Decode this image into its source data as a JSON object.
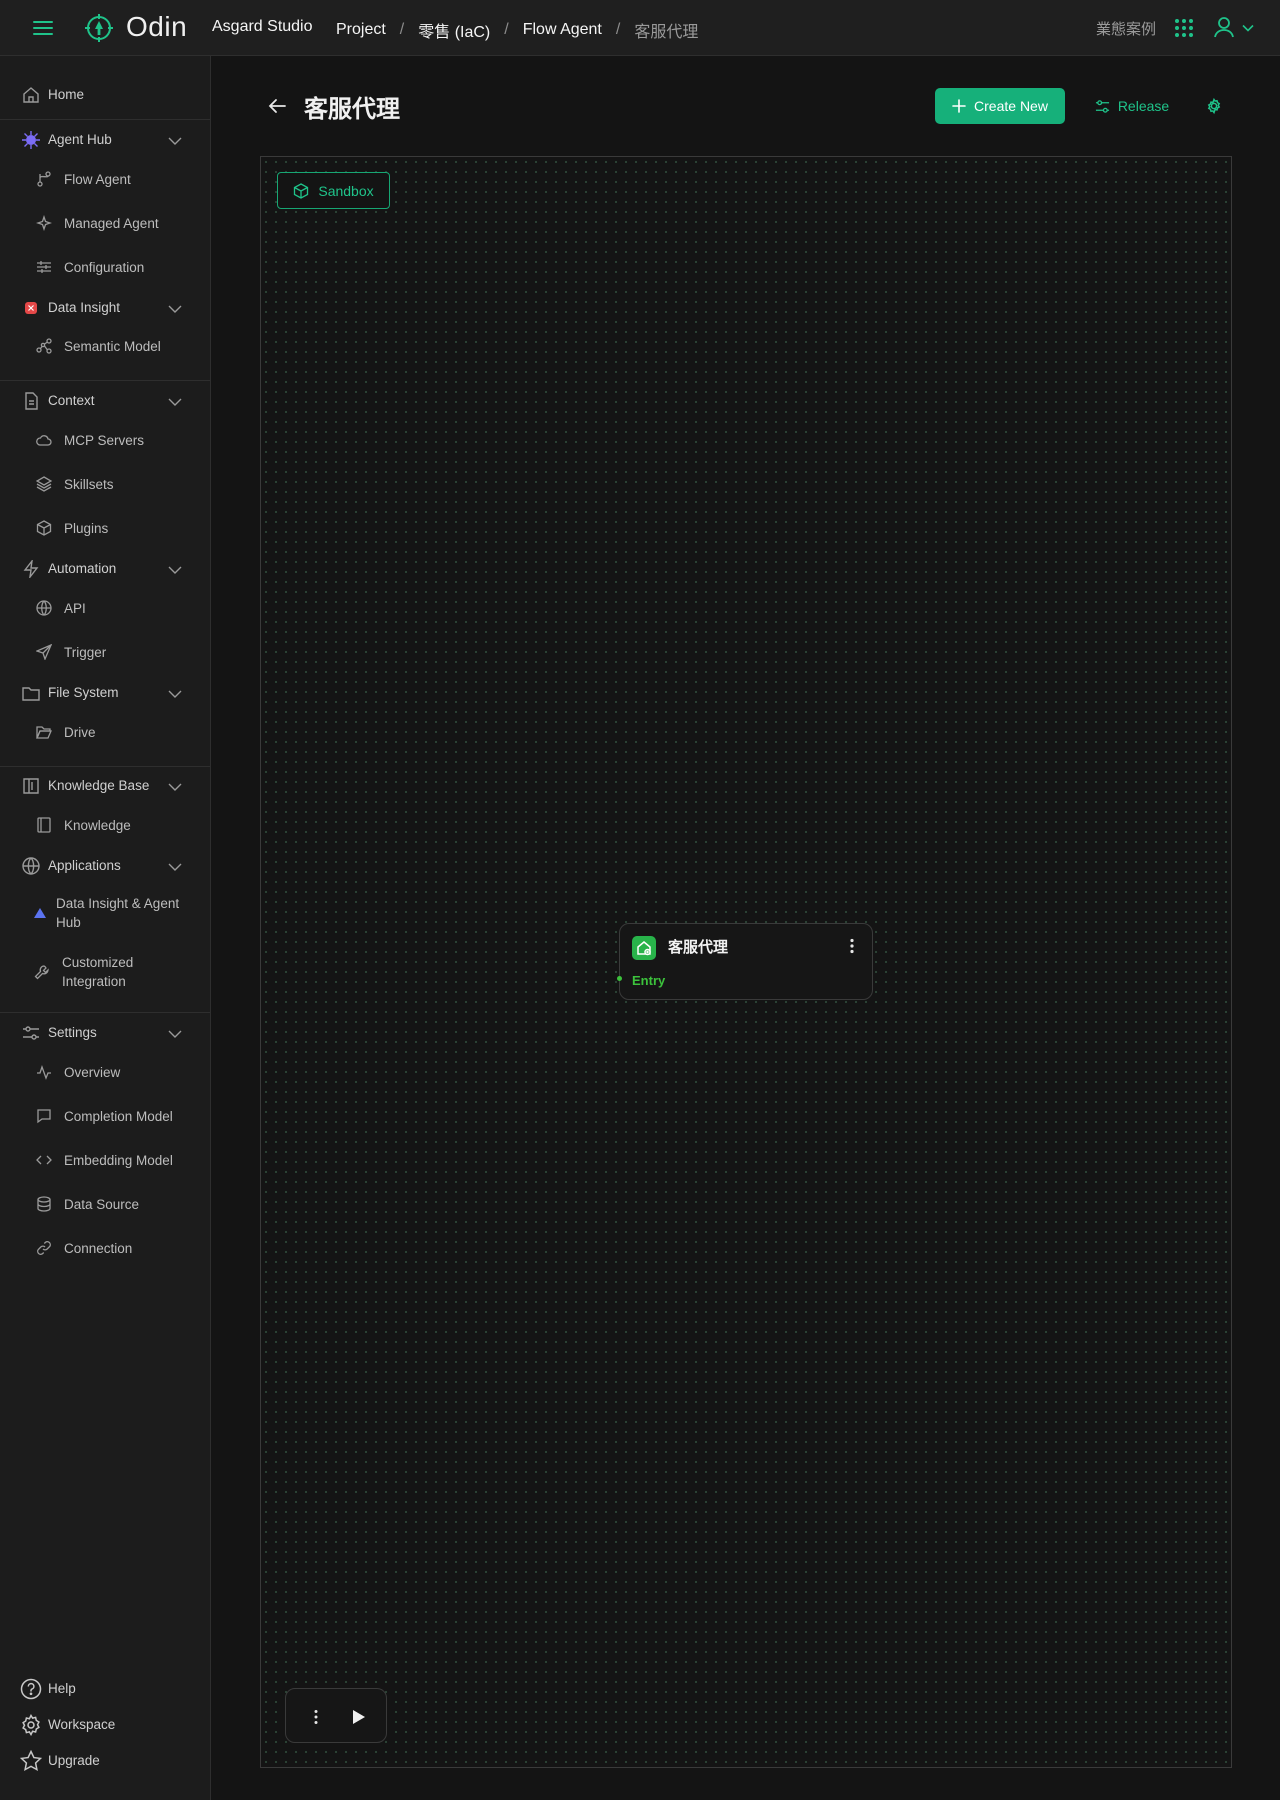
{
  "header": {
    "logo_text": "Odin",
    "studio": "Asgard Studio",
    "breadcrumb": {
      "project": "Project",
      "workspace": "零售 (IaC)",
      "section": "Flow Agent",
      "current": "客服代理"
    },
    "right_text": "業態案例",
    "icons": [
      "menu-icon",
      "odin-logo-icon",
      "apps-grid-icon",
      "user-icon",
      "chevron-down-icon"
    ]
  },
  "sidebar": {
    "home": "Home",
    "agent_hub": {
      "label": "Agent Hub",
      "items": [
        "Flow Agent",
        "Managed Agent",
        "Configuration"
      ]
    },
    "data_insight": {
      "label": "Data Insight",
      "items": [
        "Semantic Model"
      ]
    },
    "context": {
      "label": "Context",
      "items": [
        "MCP Servers",
        "Skillsets",
        "Plugins"
      ]
    },
    "automation": {
      "label": "Automation",
      "items": [
        "API",
        "Trigger"
      ]
    },
    "file_system": {
      "label": "File System",
      "items": [
        "Drive"
      ]
    },
    "knowledge_base": {
      "label": "Knowledge Base",
      "items": [
        "Knowledge"
      ]
    },
    "applications": {
      "label": "Applications",
      "items": [
        "Data Insight & Agent Hub",
        "Customized Integration"
      ]
    },
    "settings": {
      "label": "Settings",
      "items": [
        "Overview",
        "Completion Model",
        "Embedding Model",
        "Data Source",
        "Connection"
      ]
    },
    "bottom": {
      "help": "Help",
      "workspace": "Workspace",
      "upgrade": "Upgrade"
    }
  },
  "main": {
    "title": "客服代理",
    "create_label": "Create New",
    "release_label": "Release",
    "sandbox_label": "Sandbox",
    "node": {
      "title": "客服代理",
      "entry": "Entry"
    }
  },
  "colors": {
    "accent": "#16b07a",
    "accent_text": "#1fc38a",
    "node_green": "#28b34a",
    "entry_green": "#3cc23c",
    "background": "#141414",
    "sidebar": "#1c1c1c"
  }
}
